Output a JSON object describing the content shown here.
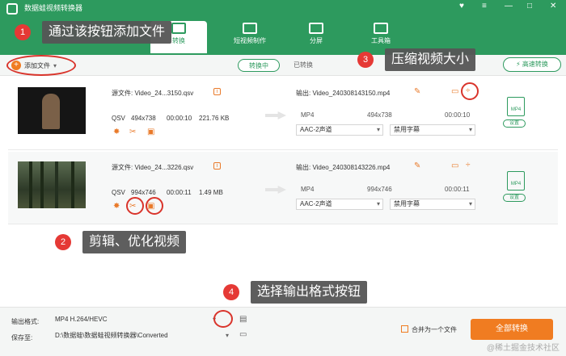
{
  "app": {
    "title": "数据蛙视频转换器",
    "win_controls": [
      "♥",
      "≡",
      "—",
      "□",
      "✕"
    ]
  },
  "nav": {
    "tabs": [
      "转换",
      "短视频制作",
      "分屏",
      "工具箱"
    ]
  },
  "toolbar": {
    "add_file": "添加文件",
    "converting": "转换中",
    "converted": "已转换",
    "fast_convert": "高速转换"
  },
  "files": [
    {
      "source": "源文件: Video_24...3150.qsv",
      "codec": "QSV",
      "resolution": "494x738",
      "duration": "00:00:10",
      "size": "221.76 KB",
      "output": "输出: Video_240308143150.mp4",
      "out_format": "MP4",
      "out_resolution": "494x738",
      "out_duration": "00:00:10",
      "audio": "AAC-2声道",
      "subtitle": "禁用字幕",
      "badge": "MP4",
      "settings": "设置"
    },
    {
      "source": "源文件: Video_24...3226.qsv",
      "codec": "QSV",
      "resolution": "994x746",
      "duration": "00:00:11",
      "size": "1.49 MB",
      "output": "输出: Video_240308143226.mp4",
      "out_format": "MP4",
      "out_resolution": "994x746",
      "out_duration": "00:00:11",
      "audio": "AAC-2声道",
      "subtitle": "禁用字幕",
      "badge": "MP4",
      "settings": "设置"
    }
  ],
  "bottom": {
    "format_label": "输出格式:",
    "format_value": "MP4 H.264/HEVC",
    "save_label": "保存至:",
    "save_path": "D:\\数据蛙\\数据蛙视频转换器\\Converted",
    "merge_label": "合并为一个文件",
    "convert_all": "全部转换"
  },
  "annotations": [
    {
      "num": "1",
      "text": "通过该按钮添加文件"
    },
    {
      "num": "2",
      "text": "剪辑、优化视频"
    },
    {
      "num": "3",
      "text": "压缩视频大小"
    },
    {
      "num": "4",
      "text": "选择输出格式按钮"
    }
  ],
  "watermark": "@稀土掘金技术社区",
  "colors": {
    "brand_green": "#2d9a5e",
    "accent_orange": "#f07c21",
    "annotation_red": "#e53935"
  }
}
